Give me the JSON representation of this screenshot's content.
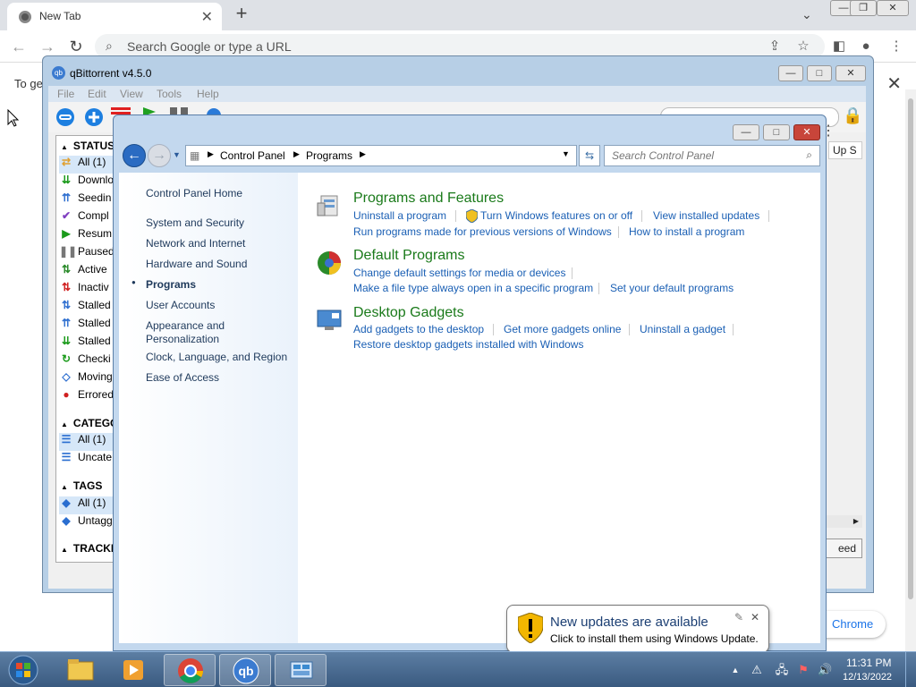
{
  "chrome": {
    "tab_title": "New Tab",
    "new_tab_symbol": "+",
    "omnibox_placeholder": "Search Google or type a URL",
    "infobar_text": "To ge",
    "side_pill_label": "Chrome"
  },
  "qbittorrent": {
    "title": "qBittorrent v4.5.0",
    "menu": [
      "File",
      "Edit",
      "View",
      "Tools",
      "Help"
    ],
    "status_header": "STATUS",
    "status_items": [
      {
        "label": "All (1)",
        "icon": "shuffle-icon",
        "color": "#e0a030"
      },
      {
        "label": "Downlo",
        "icon": "download-icon",
        "color": "#1a9a1a"
      },
      {
        "label": "Seedin",
        "icon": "upload-icon",
        "color": "#3070d0"
      },
      {
        "label": "Compl",
        "icon": "check-icon",
        "color": "#8040c0"
      },
      {
        "label": "Resum",
        "icon": "play-icon",
        "color": "#1a9a1a"
      },
      {
        "label": "Paused",
        "icon": "pause-icon",
        "color": "#777777"
      },
      {
        "label": "Active",
        "icon": "active-arrows-icon",
        "color": "#2a8a2a"
      },
      {
        "label": "Inactiv",
        "icon": "inactive-arrows-icon",
        "color": "#d02020"
      },
      {
        "label": "Stalled",
        "icon": "stalled-icon",
        "color": "#3070d0"
      },
      {
        "label": "Stalled",
        "icon": "stalled-up-icon",
        "color": "#3070d0"
      },
      {
        "label": "Stalled",
        "icon": "stalled-down-icon",
        "color": "#1a9a1a"
      },
      {
        "label": "Checki",
        "icon": "refresh-icon",
        "color": "#1a9a1a"
      },
      {
        "label": "Moving",
        "icon": "move-icon",
        "color": "#3070d0"
      },
      {
        "label": "Errored",
        "icon": "error-icon",
        "color": "#d02020"
      }
    ],
    "categories_header": "CATEGO",
    "category_items": [
      "All (1)",
      "Uncate"
    ],
    "tags_header": "TAGS",
    "tag_items": [
      "All (1)",
      "Untagg"
    ],
    "trackers_header": "TRACKE",
    "column_header_fragment": "Up S",
    "speed_button_fragment": "eed"
  },
  "control_panel": {
    "breadcrumb": [
      "Control Panel",
      "Programs"
    ],
    "search_placeholder": "Search Control Panel",
    "nav": [
      "Control Panel Home",
      "System and Security",
      "Network and Internet",
      "Hardware and Sound",
      "Programs",
      "User Accounts",
      "Appearance and",
      "Personalization",
      "Clock, Language, and Region",
      "Ease of Access"
    ],
    "categories": [
      {
        "title": "Programs and Features",
        "links": [
          "Uninstall a program",
          "Turn Windows features on or off",
          "View installed updates",
          "Run programs made for previous versions of Windows",
          "How to install a program"
        ]
      },
      {
        "title": "Default Programs",
        "links": [
          "Change default settings for media or devices",
          "Make a file type always open in a specific program",
          "Set your default programs"
        ]
      },
      {
        "title": "Desktop Gadgets",
        "links": [
          "Add gadgets to the desktop",
          "Get more gadgets online",
          "Uninstall a gadget",
          "Restore desktop gadgets installed with Windows"
        ]
      }
    ]
  },
  "notification": {
    "title": "New updates are available",
    "body": "Click to install them using Windows Update."
  },
  "taskbar": {
    "time": "11:31 PM",
    "date": "12/13/2022",
    "qb_label": "qb"
  }
}
